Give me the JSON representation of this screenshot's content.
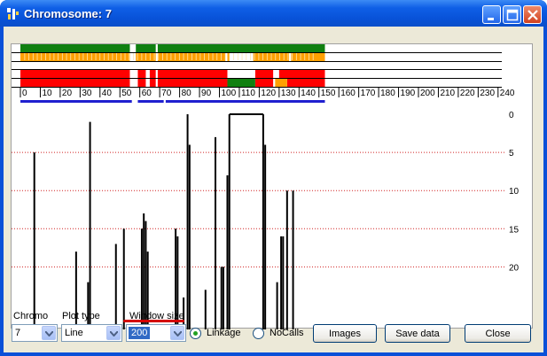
{
  "window": {
    "title": "Chromosome: 7"
  },
  "colors": {
    "green": "#108010",
    "orange": "#ffa000",
    "red": "#ff0000",
    "blue": "#2020d0",
    "dotted": "#d02020",
    "accent_underline": "#d40000"
  },
  "chart_data": {
    "type": "line",
    "x_axis": {
      "ticks": [
        0,
        10,
        20,
        30,
        40,
        50,
        60,
        70,
        80,
        90,
        100,
        110,
        120,
        130,
        140,
        150,
        160,
        170,
        180,
        190,
        200,
        210,
        220,
        230,
        240
      ],
      "range": [
        0,
        245
      ]
    },
    "y_axis": {
      "ticks": [
        0,
        5,
        10,
        15,
        20
      ],
      "range": [
        0,
        24.5
      ],
      "reversed": true,
      "grid": "dotted"
    },
    "tracks": [
      {
        "name": "green",
        "segments": [
          [
            0,
            55
          ],
          [
            58,
            68
          ],
          [
            69,
            153
          ]
        ]
      },
      {
        "name": "orange",
        "segments": [
          [
            0,
            55
          ],
          [
            58,
            68
          ],
          [
            69,
            103
          ],
          [
            104,
            105
          ],
          [
            117,
            135
          ],
          [
            136,
            153
          ]
        ]
      },
      {
        "name": "red-1",
        "segments": [
          [
            0,
            55
          ],
          [
            59,
            63
          ],
          [
            65,
            68
          ],
          [
            69,
            104
          ],
          [
            118,
            127
          ],
          [
            130,
            153
          ]
        ]
      },
      {
        "name": "red-2",
        "segments": [
          [
            0,
            55
          ],
          [
            59,
            63
          ],
          [
            65,
            68
          ],
          [
            69,
            104
          ],
          [
            118,
            127
          ],
          [
            134,
            153
          ]
        ]
      }
    ],
    "orange_patch": [
      [
        128,
        134
      ]
    ],
    "green_patch": [
      [
        104,
        118
      ]
    ],
    "blue_segments": [
      [
        0,
        56
      ],
      [
        59,
        72
      ],
      [
        73,
        153
      ]
    ],
    "series": [
      {
        "x": 7,
        "y": 5
      },
      {
        "x": 28,
        "y": 18
      },
      {
        "x": 34,
        "y": 22
      },
      {
        "x": 35,
        "y": 1
      },
      {
        "x": 48,
        "y": 17
      },
      {
        "x": 52,
        "y": 15
      },
      {
        "x": 61,
        "y": 15
      },
      {
        "x": 62,
        "y": 13
      },
      {
        "x": 63,
        "y": 14
      },
      {
        "x": 64,
        "y": 18
      },
      {
        "x": 78,
        "y": 15
      },
      {
        "x": 79,
        "y": 16
      },
      {
        "x": 82,
        "y": 24
      },
      {
        "x": 84,
        "y": 0
      },
      {
        "x": 85,
        "y": 4
      },
      {
        "x": 93,
        "y": 23
      },
      {
        "x": 98,
        "y": 3
      },
      {
        "x": 101,
        "y": 20
      },
      {
        "x": 102,
        "y": 20
      },
      {
        "x": 104,
        "y": 8
      },
      {
        "x": 105,
        "y": 0
      },
      {
        "x": 122,
        "y": 0
      },
      {
        "x": 123,
        "y": 4
      },
      {
        "x": 129,
        "y": 22
      },
      {
        "x": 131,
        "y": 16
      },
      {
        "x": 132,
        "y": 16
      },
      {
        "x": 134,
        "y": 10
      },
      {
        "x": 137,
        "y": 10
      }
    ]
  },
  "controls": {
    "chromo_label": "Chromo",
    "chromo_value": "7",
    "plot_type_label": "Plot type",
    "plot_type_value": "Line",
    "window_size_label": "Window size",
    "window_size_value": "200",
    "linkage_label": "Linkage",
    "linkage_selected": true,
    "nocalls_label": "NoCalls",
    "nocalls_selected": false,
    "images_button": "Images",
    "save_button": "Save data",
    "close_button": "Close"
  }
}
